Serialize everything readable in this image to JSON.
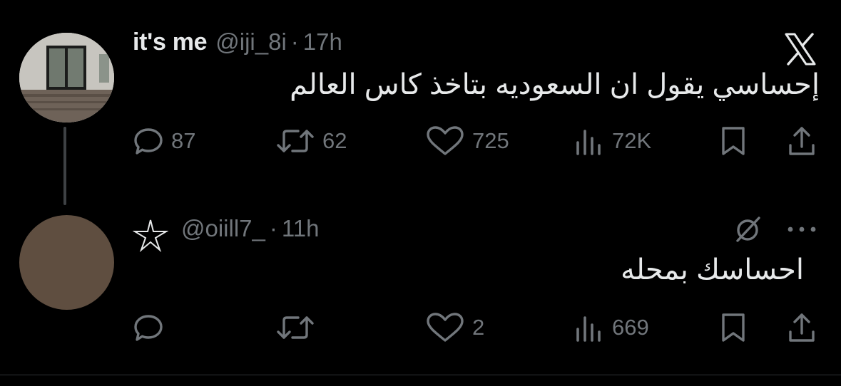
{
  "post": {
    "display_name": "it's me",
    "handle": "@iji_8i",
    "separator": "·",
    "time": "17h",
    "text": "إحساسي يقول ان السعوديه بتاخذ كاس العالم",
    "replies": "87",
    "reposts": "62",
    "likes": "725",
    "views": "72K"
  },
  "reply": {
    "name_icon": "star-icon",
    "handle": "@oiill7_",
    "separator": "·",
    "time": "11h",
    "text": "احساسك بمحله",
    "replies": "",
    "reposts": "",
    "likes": "2",
    "views": "669"
  },
  "icons": [
    "x-logo-icon",
    "reply-icon",
    "repost-icon",
    "like-icon",
    "views-icon",
    "bookmark-icon",
    "share-icon",
    "grok-icon",
    "more-icon"
  ],
  "colors": {
    "background": "#000000",
    "text": "#e7e9ea",
    "muted": "#71767b",
    "thread_line": "#3e4144"
  }
}
